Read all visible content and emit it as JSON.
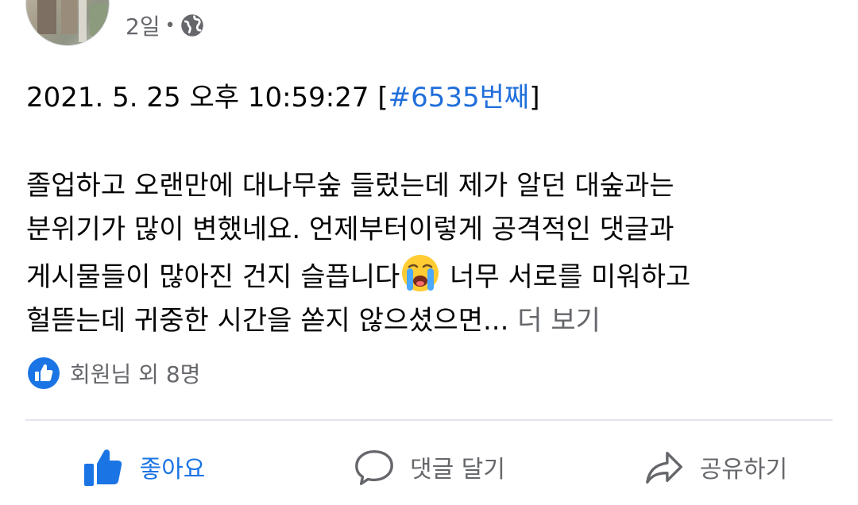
{
  "post_header": {
    "time_ago": "2일",
    "separator": "•",
    "audience_icon": "globe-icon"
  },
  "post_body": {
    "timestamp_line": "2021. 5. 25 오후 10:59:27 [",
    "hashtag": "#6535번째",
    "timestamp_close": "]",
    "para_line1": "졸업하고 오랜만에 대나무숲 들렀는데 제가 알던 대숲과는",
    "para_line2": "분위기가 많이 변했네요. 언제부터이렇게 공격적인 댓글과",
    "para_line3_before_emoji": "게시물들이 많아진 건지 슬픕니다",
    "emoji_icon": "loudly-crying-face-emoji",
    "para_line3_after_emoji": " 너무 서로를 미워하고",
    "para_line4": "헐뜯는데 귀중한 시간을 쏟지 않으셨으면...",
    "see_more": " 더 보기"
  },
  "reactions": {
    "icon": "like-reaction-icon",
    "summary": "회원님 외 8명"
  },
  "actions": [
    {
      "label": "좋아요",
      "icon": "thumbs-up-icon",
      "active": true
    },
    {
      "label": "댓글 달기",
      "icon": "comment-icon",
      "active": false
    },
    {
      "label": "공유하기",
      "icon": "share-icon",
      "active": false
    }
  ],
  "colors": {
    "accent": "#1b74e4",
    "hashtag": "#216fdb",
    "secondary_text": "#65676b",
    "primary_text": "#050505",
    "divider": "#e4e6eb"
  }
}
